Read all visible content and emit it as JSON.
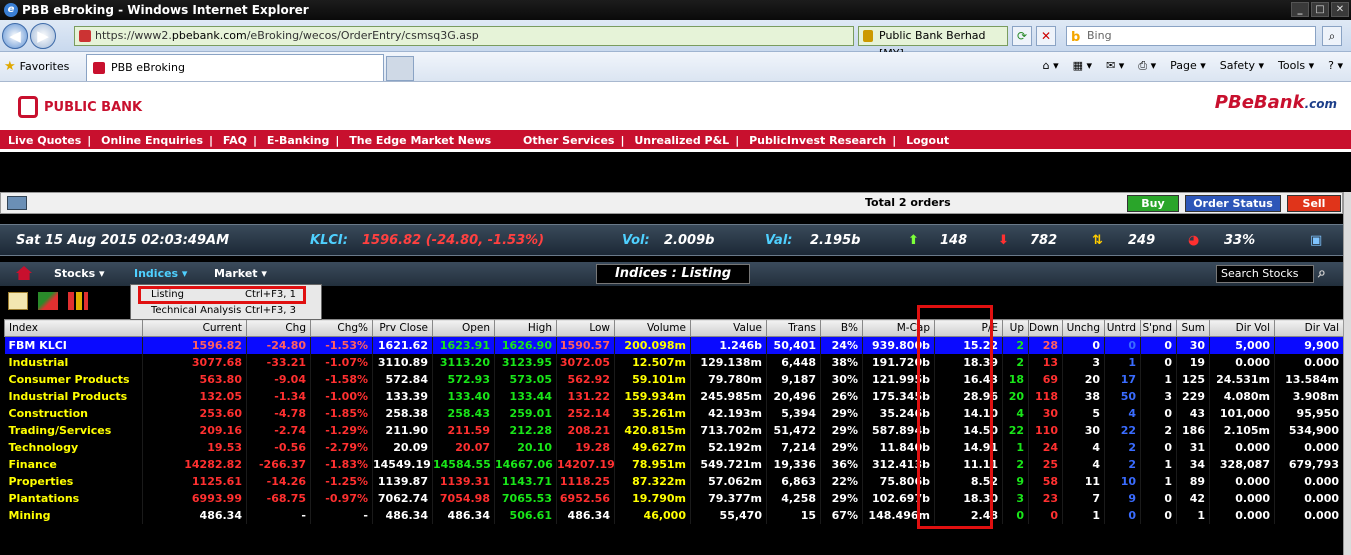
{
  "window": {
    "title": "PBB eBroking - Windows Internet Explorer",
    "controls": [
      "_",
      "□",
      "✕"
    ]
  },
  "browser": {
    "url_prefix": "https://www2.",
    "url_host": "pbebank.com",
    "url_path": "/eBroking/wecos/OrderEntry/csmsq3G.asp",
    "cert": "Public Bank Berhad [MY]",
    "search_placeholder": "Bing",
    "favorites": "Favorites",
    "tab_title": "PBB eBroking",
    "commands": [
      "Page ▾",
      "Safety ▾",
      "Tools ▾",
      "? ▾"
    ]
  },
  "site": {
    "logo_text": "PUBLIC BANK",
    "ebank_text": "PBeBank",
    "ebank_suffix": ".com",
    "nav": [
      "Live Quotes",
      "Online Enquiries",
      "FAQ",
      "E-Banking",
      "The Edge Market News",
      "Other Services",
      "Unrealized P&L",
      "PublicInvest Research",
      "Logout"
    ]
  },
  "orders": {
    "total": "Total 2 orders",
    "buy": "Buy",
    "status": "Order Status",
    "sell": "Sell"
  },
  "ticker": {
    "datetime": "Sat 15 Aug 2015   02:03:49AM",
    "klci_label": "KLCI:",
    "klci_value": "1596.82 (-24.80, -1.53%)",
    "vol_label": "Vol:",
    "vol_value": "2.009b",
    "val_label": "Val:",
    "val_value": "2.195b",
    "up": "148",
    "down": "782",
    "unchg": "249",
    "pct": "33%"
  },
  "submenu": {
    "stocks": "Stocks ▾",
    "indices": "Indices ▾",
    "market": "Market ▾",
    "title": "Indices : Listing",
    "search": "Search Stocks"
  },
  "dropdown": {
    "items": [
      {
        "label": "Listing",
        "key": "Ctrl+F3, 1"
      },
      {
        "label": "Technical Analysis",
        "key": "Ctrl+F3, 3"
      }
    ]
  },
  "table": {
    "headers": [
      "Index",
      "Current",
      "Chg",
      "Chg%",
      "Prv Close",
      "Open",
      "High",
      "Low",
      "Volume",
      "Value",
      "Trans",
      "B%",
      "M-Cap",
      "P/E",
      "Up",
      "Down",
      "Unchg",
      "Untrd",
      "S'pnd",
      "Sum",
      "Dir Vol",
      "Dir Val"
    ],
    "rows": [
      [
        "FBM KLCI",
        "1596.82",
        "-24.80",
        "-1.53%",
        "1621.62",
        "1623.91",
        "1626.90",
        "1590.57",
        "200.098m",
        "1.246b",
        "50,401",
        "24%",
        "939.800b",
        "15.22",
        "2",
        "28",
        "0",
        "0",
        "0",
        "30",
        "5,000",
        "9,900"
      ],
      [
        "Industrial",
        "3077.68",
        "-33.21",
        "-1.07%",
        "3110.89",
        "3113.20",
        "3123.95",
        "3072.05",
        "12.507m",
        "129.138m",
        "6,448",
        "38%",
        "191.720b",
        "18.39",
        "2",
        "13",
        "3",
        "1",
        "0",
        "19",
        "0.000",
        "0.000"
      ],
      [
        "Consumer Products",
        "563.80",
        "-9.04",
        "-1.58%",
        "572.84",
        "572.93",
        "573.05",
        "562.92",
        "59.101m",
        "79.780m",
        "9,187",
        "30%",
        "121.995b",
        "16.43",
        "18",
        "69",
        "20",
        "17",
        "1",
        "125",
        "24.531m",
        "13.584m"
      ],
      [
        "Industrial Products",
        "132.05",
        "-1.34",
        "-1.00%",
        "133.39",
        "133.40",
        "133.44",
        "131.22",
        "159.934m",
        "245.985m",
        "20,496",
        "26%",
        "175.345b",
        "28.96",
        "20",
        "118",
        "38",
        "50",
        "3",
        "229",
        "4.080m",
        "3.908m"
      ],
      [
        "Construction",
        "253.60",
        "-4.78",
        "-1.85%",
        "258.38",
        "258.43",
        "259.01",
        "252.14",
        "35.261m",
        "42.193m",
        "5,394",
        "29%",
        "35.246b",
        "14.10",
        "4",
        "30",
        "5",
        "4",
        "0",
        "43",
        "101,000",
        "95,950"
      ],
      [
        "Trading/Services",
        "209.16",
        "-2.74",
        "-1.29%",
        "211.90",
        "211.59",
        "212.28",
        "208.21",
        "420.815m",
        "713.702m",
        "51,472",
        "29%",
        "587.894b",
        "14.50",
        "22",
        "110",
        "30",
        "22",
        "2",
        "186",
        "2.105m",
        "534,900"
      ],
      [
        "Technology",
        "19.53",
        "-0.56",
        "-2.79%",
        "20.09",
        "20.07",
        "20.10",
        "19.28",
        "49.627m",
        "52.192m",
        "7,214",
        "29%",
        "11.840b",
        "14.91",
        "1",
        "24",
        "4",
        "2",
        "0",
        "31",
        "0.000",
        "0.000"
      ],
      [
        "Finance",
        "14282.82",
        "-266.37",
        "-1.83%",
        "14549.19",
        "14584.55",
        "14667.06",
        "14207.19",
        "78.951m",
        "549.721m",
        "19,336",
        "36%",
        "312.413b",
        "11.11",
        "2",
        "25",
        "4",
        "2",
        "1",
        "34",
        "328,087",
        "679,793"
      ],
      [
        "Properties",
        "1125.61",
        "-14.26",
        "-1.25%",
        "1139.87",
        "1139.31",
        "1143.71",
        "1118.25",
        "87.322m",
        "57.062m",
        "6,863",
        "22%",
        "75.806b",
        "8.52",
        "9",
        "58",
        "11",
        "10",
        "1",
        "89",
        "0.000",
        "0.000"
      ],
      [
        "Plantations",
        "6993.99",
        "-68.75",
        "-0.97%",
        "7062.74",
        "7054.98",
        "7065.53",
        "6952.56",
        "19.790m",
        "79.377m",
        "4,258",
        "29%",
        "102.697b",
        "18.30",
        "3",
        "23",
        "7",
        "9",
        "0",
        "42",
        "0.000",
        "0.000"
      ],
      [
        "Mining",
        "486.34",
        "-",
        "-",
        "486.34",
        "486.34",
        "506.61",
        "486.34",
        "46,000",
        "55,470",
        "15",
        "67%",
        "148.496m",
        "2.48",
        "0",
        "0",
        "1",
        "0",
        "0",
        "1",
        "0.000",
        "0.000"
      ]
    ]
  }
}
